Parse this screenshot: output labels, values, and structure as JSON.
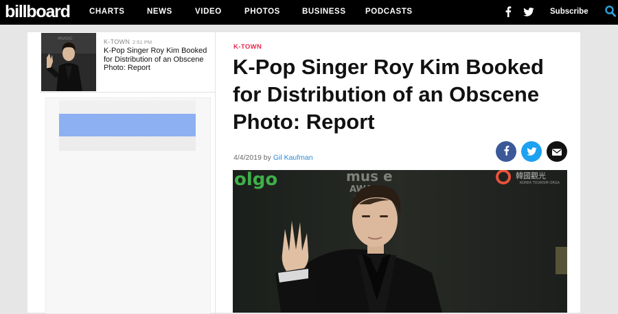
{
  "nav": {
    "logo": "billboard",
    "links": [
      "CHARTS",
      "NEWS",
      "VIDEO",
      "PHOTOS",
      "BUSINESS",
      "PODCASTS"
    ],
    "subscribe": "Subscribe",
    "icons": [
      "facebook-icon",
      "twitter-icon",
      "search-icon"
    ]
  },
  "rail": {
    "story": {
      "category": "K-TOWN",
      "time": "2:51 PM",
      "title": "K-Pop Singer Roy Kim Booked for Distribution of an Obscene Photo: Report"
    }
  },
  "article": {
    "category": "K-TOWN",
    "headline": "K-Pop Singer Roy Kim Booked for Distribution of an Obscene Photo: Report",
    "date": "4/4/2019",
    "by": "by",
    "author": "Gil Kaufman",
    "share": [
      "facebook-icon",
      "twitter-icon",
      "email-icon"
    ]
  },
  "colors": {
    "nav_bg": "#000000",
    "accent": "#e8294a",
    "link": "#2a8bd8",
    "facebook": "#3b5998",
    "twitter": "#1da1f2",
    "email": "#111111"
  }
}
